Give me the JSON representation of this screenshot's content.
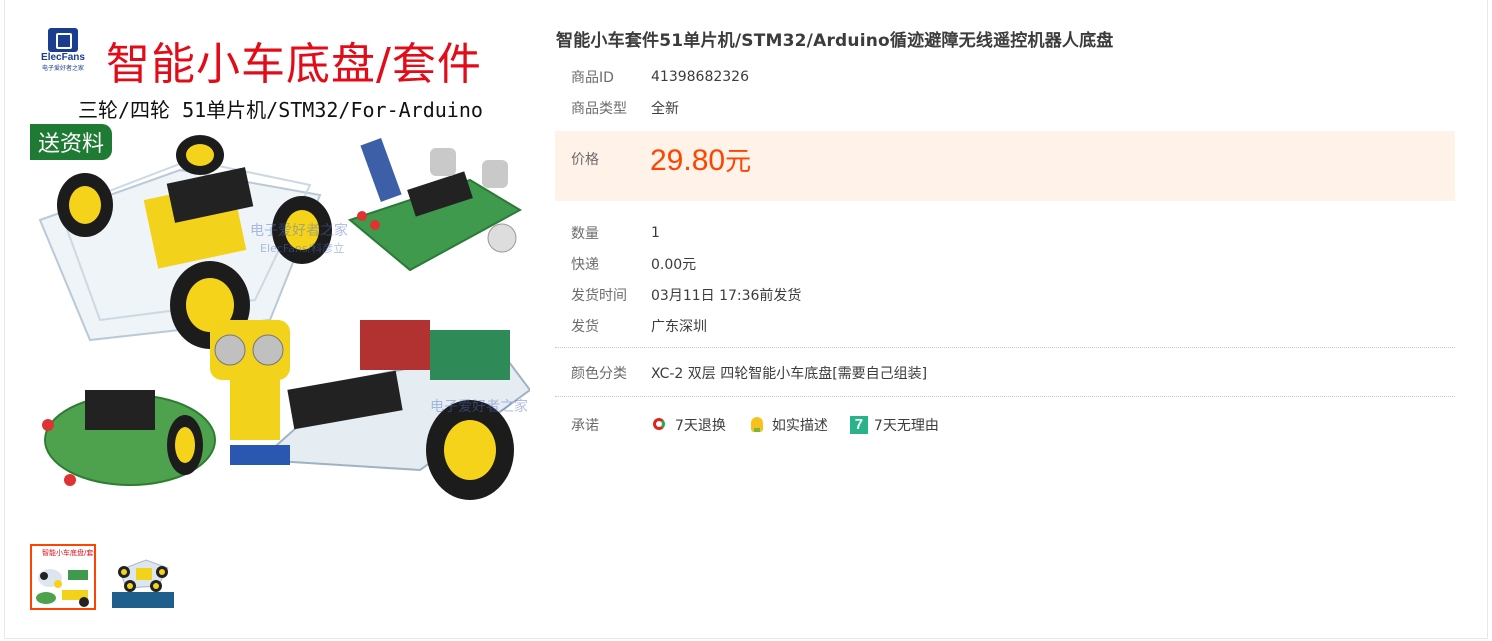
{
  "gallery": {
    "main_image": {
      "brand_logo_text": "ElecFans",
      "brand_logo_sub": "电子爱好者之家",
      "headline": "智能小车底盘/套件",
      "subheadline": "三轮/四轮 51单片机/STM32/For-Arduino",
      "badge": "送资料",
      "watermark_1": "电子爱好者之家",
      "watermark_2": "ElecFans/科彦立",
      "watermark_3": "电子爱好者之家"
    },
    "thumbnails": [
      {
        "caption": "智能小车底盘/套件",
        "active": true
      },
      {
        "caption": "",
        "active": false
      }
    ]
  },
  "product": {
    "title": "智能小车套件51单片机/STM32/Arduino循迹避障无线遥控机器人底盘",
    "id_label": "商品ID",
    "id_value": "41398682326",
    "type_label": "商品类型",
    "type_value": "全新",
    "price_label": "价格",
    "price_value": "29.80",
    "price_unit": "元",
    "qty_label": "数量",
    "qty_value": "1",
    "shipping_label": "快递",
    "shipping_value": "0.00元",
    "ship_time_label": "发货时间",
    "ship_time_value": "03月11日 17:36前发货",
    "origin_label": "发货",
    "origin_value": "广东深圳",
    "color_label": "颜色分类",
    "color_value": "XC-2 双层 四轮智能小车底盘[需要自己组装]",
    "promise_label": "承诺",
    "promises": [
      {
        "label": "7天退换",
        "icon": "return-icon"
      },
      {
        "label": "如实描述",
        "icon": "describe-icon"
      },
      {
        "label": "7天无理由",
        "icon": "seven-day-icon"
      }
    ]
  },
  "colors": {
    "price": "#ff4400",
    "price_bg": "#fff2e8",
    "thumb_active_border": "#ff4400"
  }
}
